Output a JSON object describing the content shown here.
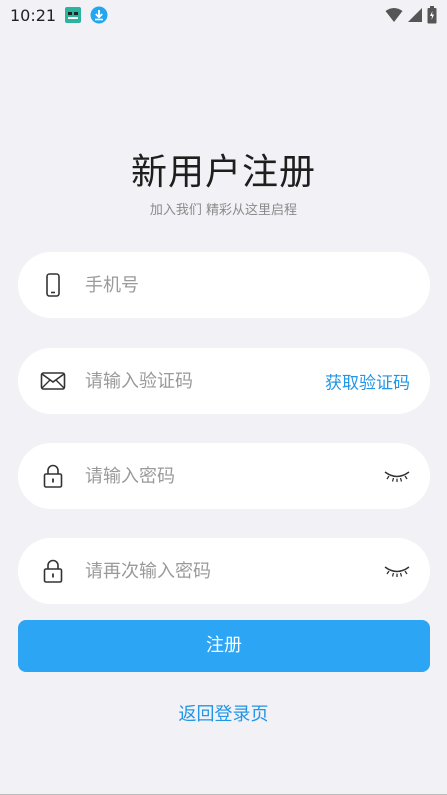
{
  "status_bar": {
    "time": "10:21"
  },
  "header": {
    "title": "新用户注册",
    "subtitle": "加入我们 精彩从这里启程"
  },
  "form": {
    "phone": {
      "placeholder": "手机号",
      "value": ""
    },
    "code": {
      "placeholder": "请输入验证码",
      "value": "",
      "get_code_label": "获取验证码"
    },
    "password": {
      "placeholder": "请输入密码",
      "value": ""
    },
    "confirm_password": {
      "placeholder": "请再次输入密码",
      "value": ""
    }
  },
  "actions": {
    "register_label": "注册",
    "back_label": "返回登录页"
  },
  "colors": {
    "accent": "#2ca5f5",
    "link": "#2196e6",
    "background": "#f2f2f6"
  }
}
